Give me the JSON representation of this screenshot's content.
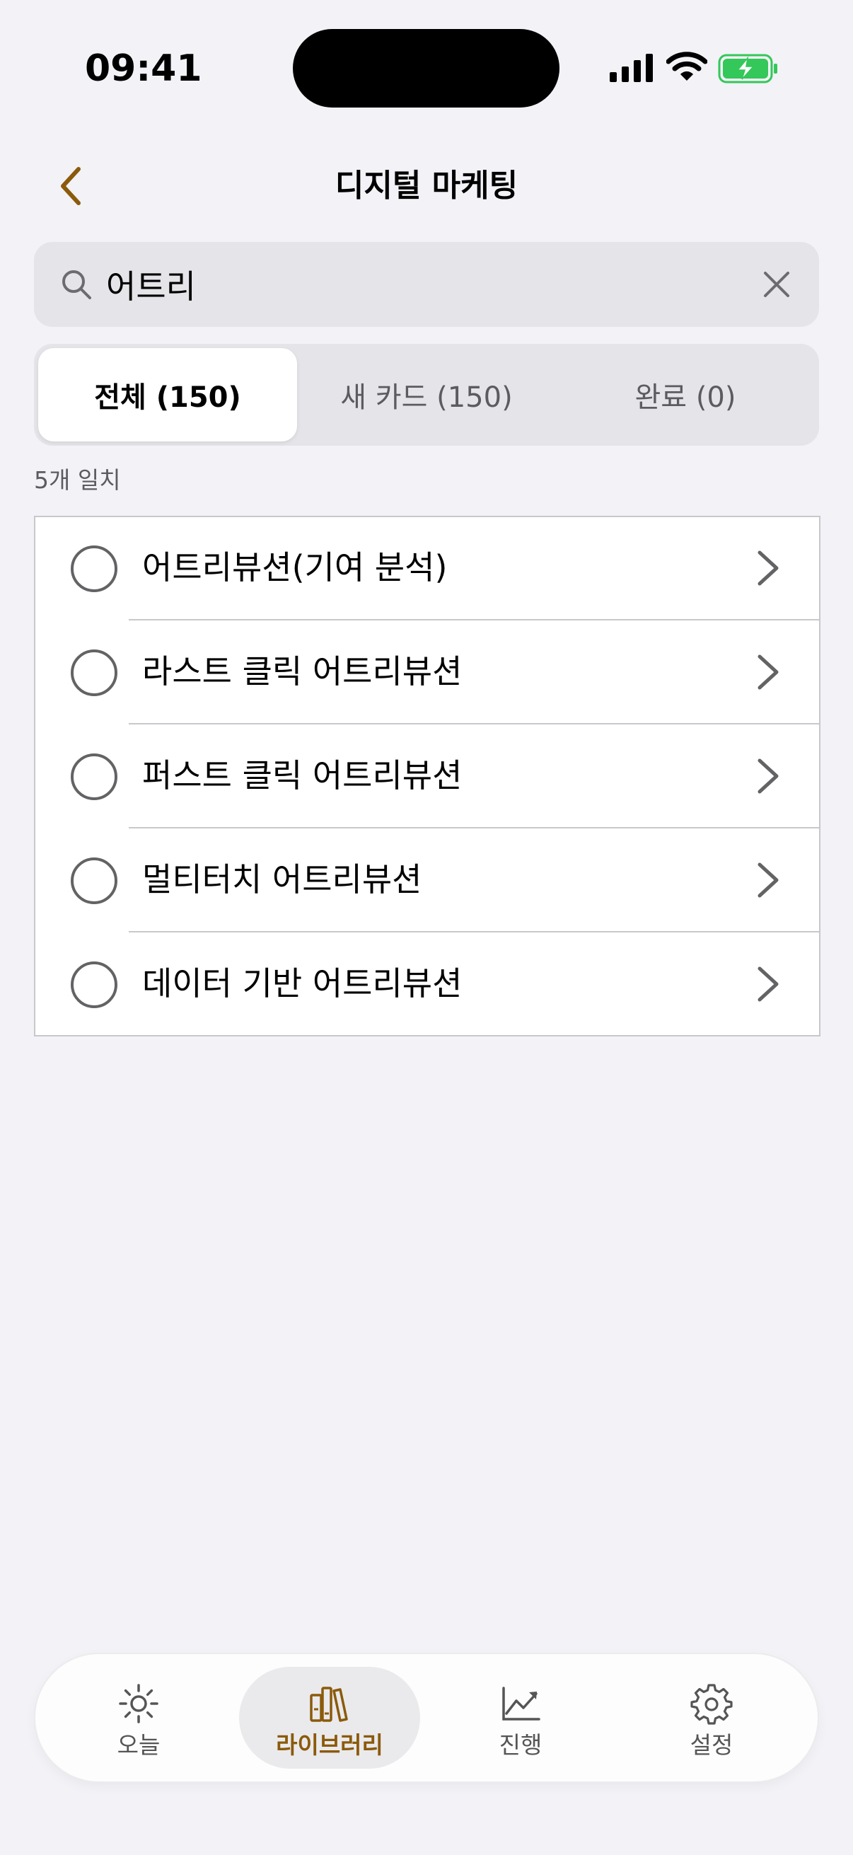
{
  "status_bar": {
    "time": "09:41"
  },
  "nav": {
    "title": "디지털 마케팅",
    "accent_color": "#8B5A0A"
  },
  "search": {
    "value": "어트리",
    "placeholder": ""
  },
  "segments": [
    {
      "label": "전체 (150)",
      "active": true
    },
    {
      "label": "새 카드 (150)",
      "active": false
    },
    {
      "label": "완료 (0)",
      "active": false
    }
  ],
  "match_count": "5개 일치",
  "results": [
    {
      "label": "어트리뷰션(기여 분석)"
    },
    {
      "label": "라스트 클릭 어트리뷰션"
    },
    {
      "label": "퍼스트 클릭 어트리뷰션"
    },
    {
      "label": "멀티터치 어트리뷰션"
    },
    {
      "label": "데이터 기반 어트리뷰션"
    }
  ],
  "tab_bar": {
    "tabs": [
      {
        "label": "오늘",
        "icon": "sun-icon",
        "active": false
      },
      {
        "label": "라이브러리",
        "icon": "books-icon",
        "active": true
      },
      {
        "label": "진행",
        "icon": "chart-trend-icon",
        "active": false
      },
      {
        "label": "설정",
        "icon": "gear-icon",
        "active": false
      }
    ]
  }
}
